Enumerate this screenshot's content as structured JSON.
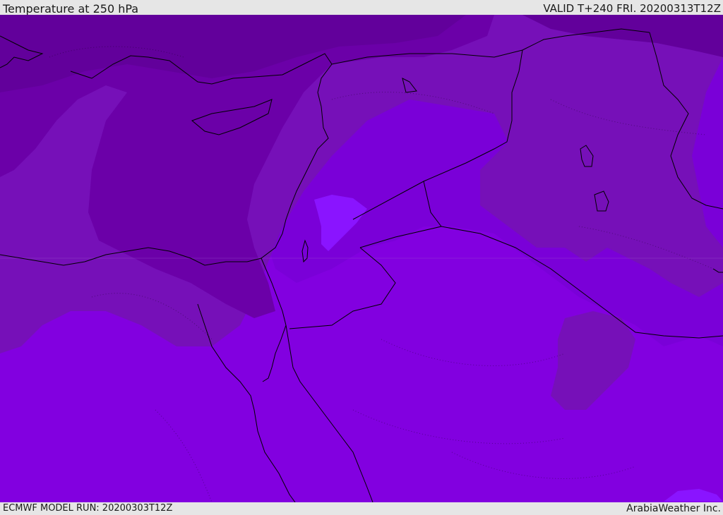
{
  "header": {
    "title": "Temperature at 250 hPa",
    "valid_time": "VALID T+240 FRI. 20200313T12Z"
  },
  "footer": {
    "model_run": "ECMWF MODEL RUN: 20200303T12Z",
    "credit": "ArabiaWeather Inc."
  },
  "map": {
    "variable": "temperature",
    "pressure_level_hpa": 250,
    "colors": {
      "coldest": "#62009b",
      "cold": "#6b00a8",
      "cool": "#7610b8",
      "mid": "#7a00d8",
      "warm": "#8200e0",
      "warmest": "#8a14ff",
      "border_line": "#000000"
    }
  }
}
